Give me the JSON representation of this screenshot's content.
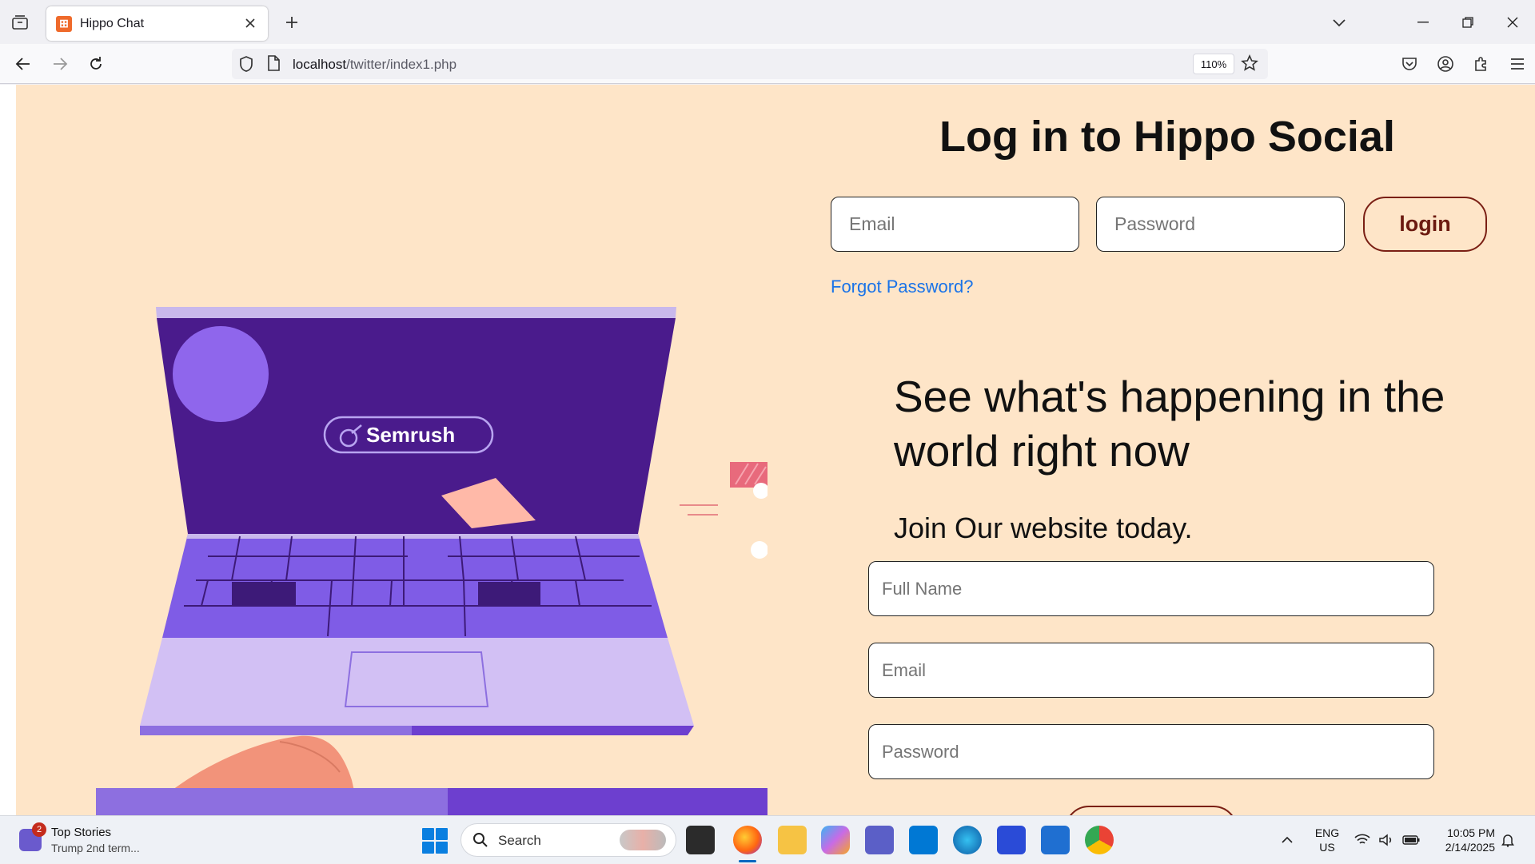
{
  "browser": {
    "tab_title": "Hippo Chat",
    "url_host": "localhost",
    "url_path": "/twitter/index1.php",
    "zoom": "110%",
    "favicon_glyph": "⊞"
  },
  "login": {
    "title": "Log in to Hippo Social",
    "email_placeholder": "Email",
    "password_placeholder": "Password",
    "login_label": "login",
    "forgot_label": "Forgot Password?"
  },
  "hero": {
    "laptop_brand": "Semrush"
  },
  "signup": {
    "headline": "See what's happening in the world right now",
    "join_text": "Join Our website today.",
    "fullname_placeholder": "Full Name",
    "email_placeholder": "Email",
    "password_placeholder": "Password"
  },
  "taskbar": {
    "news_badge": "2",
    "news_title": "Top Stories",
    "news_subtitle": "Trump 2nd term...",
    "search_label": "Search",
    "lang_line1": "ENG",
    "lang_line2": "US",
    "time": "10:05 PM",
    "date": "2/14/2025"
  },
  "colors": {
    "page_bg": "#fee5c8",
    "link": "#1a73e8",
    "button_border": "#7a1f14",
    "laptop_screen": "#4b1a8e",
    "laptop_keys": "#7f5ce6"
  }
}
